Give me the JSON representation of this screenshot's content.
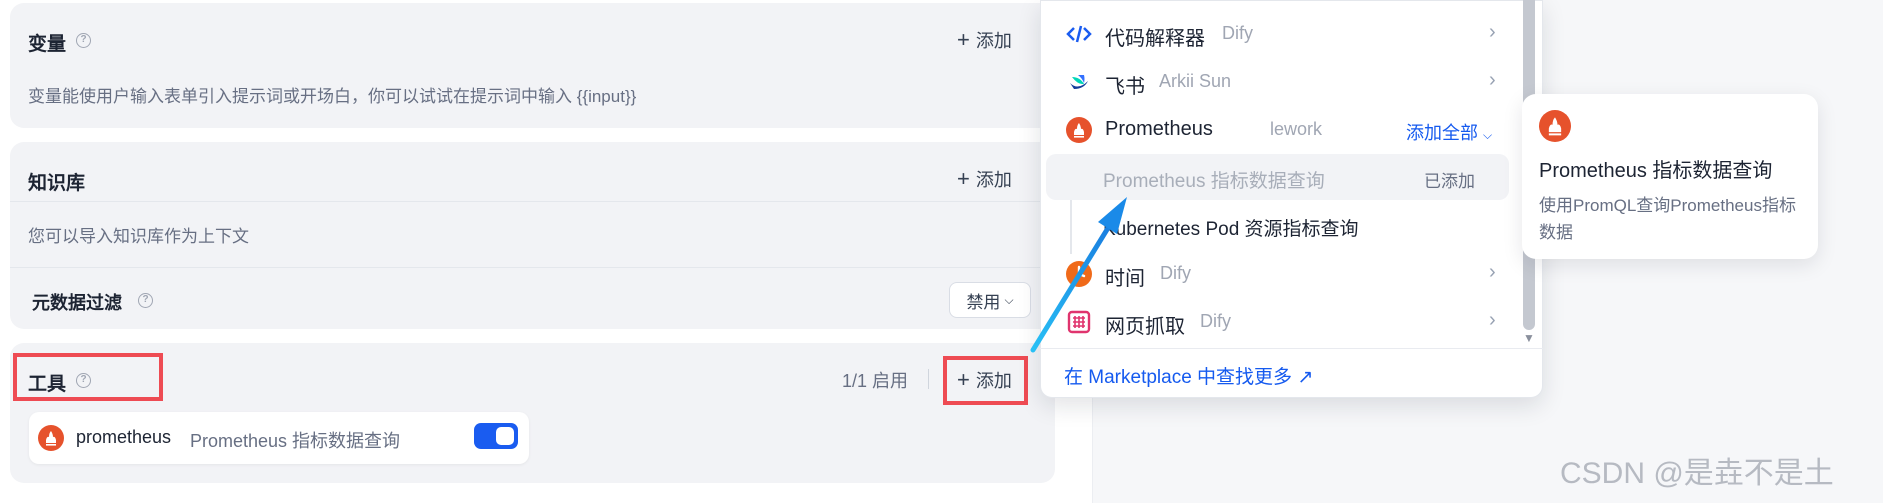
{
  "variables": {
    "title": "变量",
    "add_label": "添加",
    "description": "变量能使用户输入表单引入提示词或开场白，你可以试试在提示词中输入 {{input}}"
  },
  "knowledge": {
    "title": "知识库",
    "add_label": "添加",
    "description": "您可以导入知识库作为上下文",
    "metadata_filter": "元数据过滤",
    "filter_value": "禁用"
  },
  "tools": {
    "title": "工具",
    "enabled_count": "1/1 启用",
    "add_label": "添加",
    "item": {
      "name": "prometheus",
      "description": "Prometheus 指标数据查询",
      "enabled": true
    }
  },
  "dropdown": {
    "providers": [
      {
        "name": "代码解释器",
        "author": "Dify",
        "icon": "code-icon"
      },
      {
        "name": "飞书",
        "author": "Arkii Sun",
        "icon": "feishu-icon"
      },
      {
        "name": "Prometheus",
        "author": "lework",
        "icon": "prometheus-icon",
        "action": "添加全部"
      },
      {
        "name": "时间",
        "author": "Dify",
        "icon": "clock-icon"
      },
      {
        "name": "网页抓取",
        "author": "Dify",
        "icon": "web-scraper-icon"
      }
    ],
    "prometheus_tools": [
      {
        "name": "Prometheus 指标数据查询",
        "status": "已添加"
      },
      {
        "name": "Kubernetes Pod 资源指标查询"
      }
    ],
    "marketplace_link": "在 Marketplace 中查找更多 ↗"
  },
  "tooltip": {
    "title": "Prometheus 指标数据查询",
    "description": "使用PromQL查询Prometheus指标数据"
  },
  "watermark": "CSDN @是垚不是土",
  "colors": {
    "accent": "#155aef",
    "highlight": "#ee4b53",
    "arrow": "#1ea0f0",
    "prometheus": "#e6522c"
  }
}
